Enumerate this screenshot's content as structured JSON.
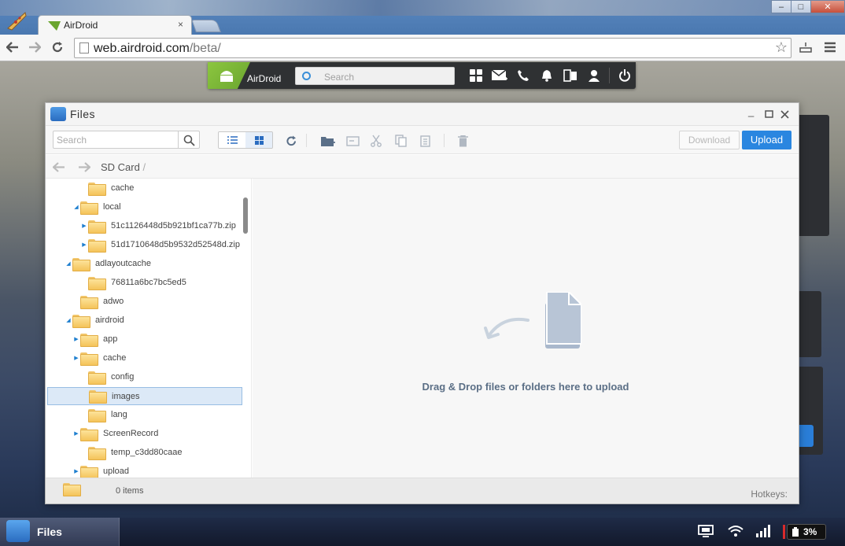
{
  "browser": {
    "tab_title": "AirDroid",
    "tab_close": "×",
    "url_host": "web.airdroid.com",
    "url_path": "/beta/",
    "window_min": "–",
    "window_max": "□",
    "window_close": "✕"
  },
  "airdroid_bar": {
    "logo_text": "AirDroid",
    "search_placeholder": "Search",
    "icons": [
      "apps-icon",
      "messages-icon",
      "phone-icon",
      "notifications-icon",
      "mirror-icon",
      "account-icon",
      "power-icon"
    ]
  },
  "files_window": {
    "title": "Files",
    "search_placeholder": "Search",
    "download_label": "Download",
    "upload_label": "Upload",
    "path_root": "SD Card",
    "path_sep": "/",
    "drop_text": "Drag & Drop files or folders here to upload",
    "item_count": "0 items",
    "hotkeys_label": "Hotkeys:",
    "tree": [
      {
        "name": "cache",
        "arrow": ""
      },
      {
        "name": "local",
        "arrow": "expanded"
      },
      {
        "name": "51c1126448d5b921bf1ca77b.zip",
        "arrow": "collapsed"
      },
      {
        "name": "51d1710648d5b9532d52548d.zip",
        "arrow": "collapsed"
      },
      {
        "name": "adlayoutcache",
        "arrow": "expanded"
      },
      {
        "name": "76811a6bc7bc5ed5",
        "arrow": ""
      },
      {
        "name": "adwo",
        "arrow": ""
      },
      {
        "name": "airdroid",
        "arrow": "expanded"
      },
      {
        "name": "app",
        "arrow": "collapsed"
      },
      {
        "name": "cache",
        "arrow": "collapsed"
      },
      {
        "name": "config",
        "arrow": ""
      },
      {
        "name": "images",
        "arrow": "",
        "selected": true
      },
      {
        "name": "lang",
        "arrow": ""
      },
      {
        "name": "ScreenRecord",
        "arrow": "collapsed"
      },
      {
        "name": "temp_c3dd80caae",
        "arrow": ""
      },
      {
        "name": "upload",
        "arrow": "collapsed"
      }
    ]
  },
  "taskbar": {
    "app_label": "Files",
    "battery_text": "3%"
  },
  "colors": {
    "accent": "#2a86e0",
    "airdroid_green": "#8cc63f",
    "bar_dark": "#2f3133"
  }
}
